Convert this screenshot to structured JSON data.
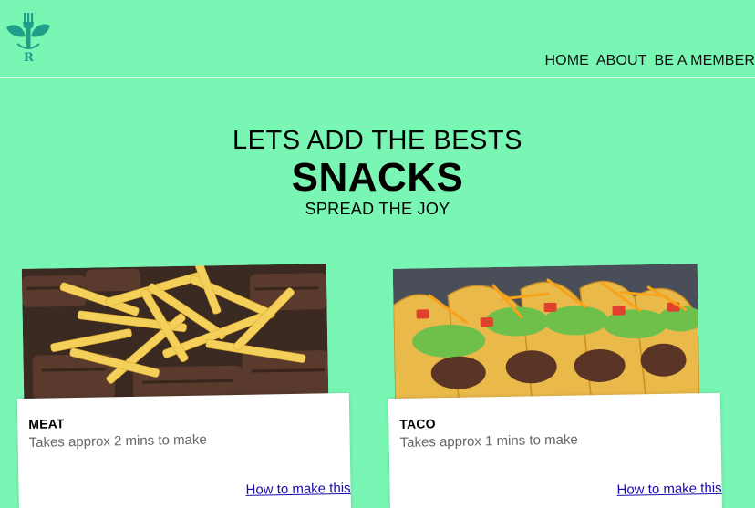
{
  "logo": {
    "letter": "R",
    "icon": "fork-leaf-icon",
    "color": "#1f9e8a"
  },
  "nav": {
    "items": [
      {
        "label": "HOME"
      },
      {
        "label": "ABOUT"
      },
      {
        "label": "BE A MEMBER"
      }
    ]
  },
  "hero": {
    "line1": "LETS ADD THE BESTS",
    "line2": "SNACKS",
    "line3": "SPREAD THE JOY"
  },
  "cards": [
    {
      "title": "MEAT",
      "description": "Takes approx 2 mins to make",
      "link": "How to make this",
      "image": "fries-and-steak-image"
    },
    {
      "title": "TACO",
      "description": "Takes approx 1 mins to make",
      "link": "How to make this",
      "image": "tacos-image"
    }
  ],
  "colors": {
    "background": "#79f5b4",
    "link": "#1a0dab",
    "card": "#ffffff"
  }
}
